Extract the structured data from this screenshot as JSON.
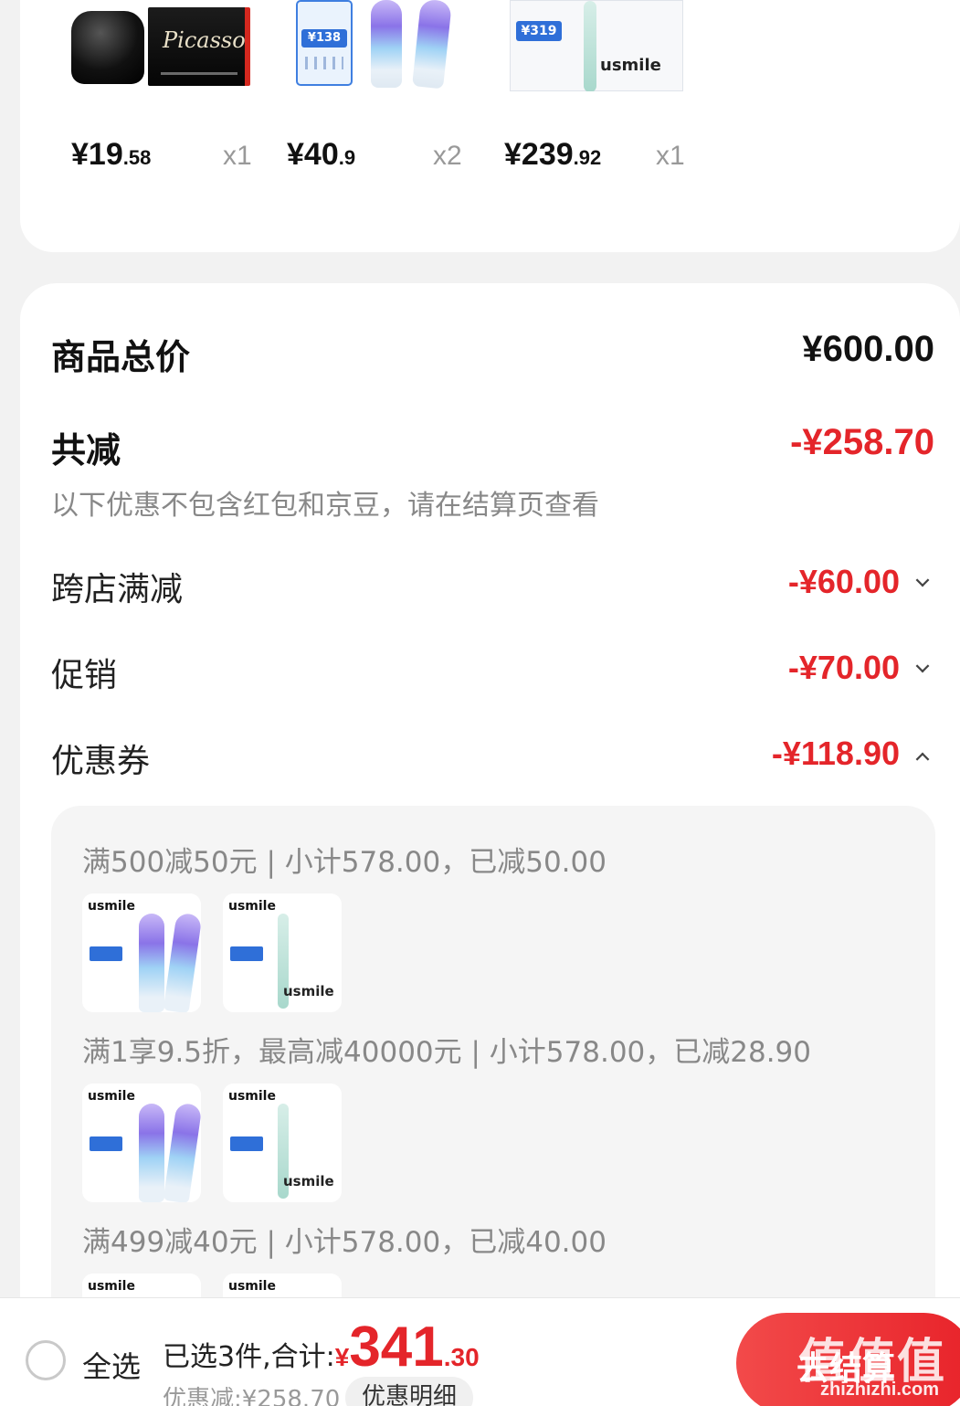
{
  "top_products": [
    {
      "image": "ink-bottle-and-box",
      "price_int": "¥19",
      "price_dec": ".58",
      "qty": "x1"
    },
    {
      "image": "toothbrush-heads-pack",
      "price_int": "¥40",
      "price_dec": ".9",
      "qty": "x2"
    },
    {
      "image": "electric-toothbrush-box",
      "price_int": "¥239",
      "price_dec": ".92",
      "qty": "x1"
    }
  ],
  "product_images": {
    "ink_signature": "Picasso",
    "head_card_price": "¥138",
    "box_card_price": "¥319",
    "brand": "usmile"
  },
  "summary": {
    "total_label": "商品总价",
    "total_value": "¥600.00",
    "reduce_label": "共减",
    "reduce_value": "-¥258.70",
    "note": "以下优惠不包含红包和京豆，请在结算页查看",
    "cross_store_label": "跨店满减",
    "cross_store_value": "-¥60.00",
    "promo_label": "促销",
    "promo_value": "-¥70.00",
    "coupon_label": "优惠券",
    "coupon_value": "-¥118.90"
  },
  "coupons": [
    {
      "text": "满500减50元 | 小计578.00，已减50.00"
    },
    {
      "text": "满1享9.5折，最高减40000元 | 小计578.00，已减28.90"
    },
    {
      "text": "满499减40元 | 小计578.00，已减40.00"
    }
  ],
  "bottom_bar": {
    "select_all": "全选",
    "selected_text": "已选3件,合计:",
    "currency": "¥",
    "total_int": "341",
    "total_dec": ".30",
    "discount_text": "优惠减:¥258.70",
    "detail_button": "优惠明细",
    "checkout_button": "去结算"
  },
  "watermark": {
    "text": "值值值",
    "url": "zhizhizhi.com"
  },
  "colors": {
    "accent": "#e4252a",
    "background": "#f2f2f2",
    "card": "#ffffff"
  }
}
